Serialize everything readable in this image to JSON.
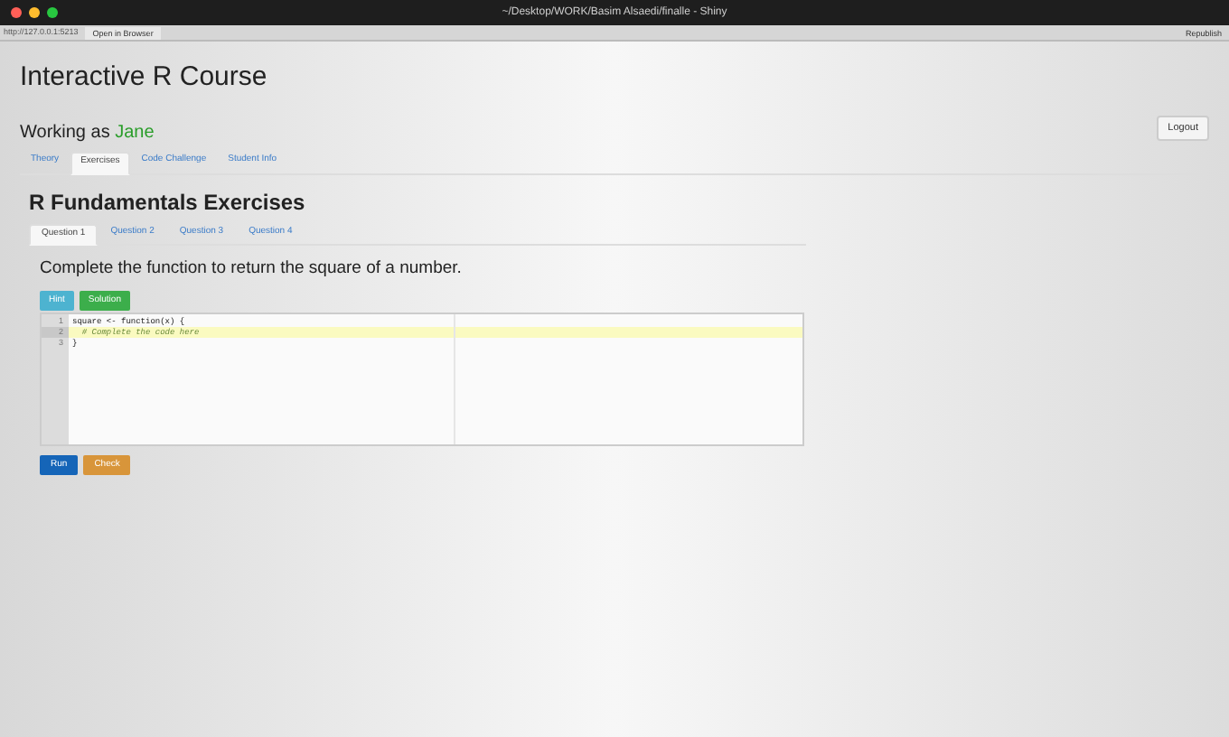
{
  "window": {
    "title": "~/Desktop/WORK/Basim Alsaedi/finalle - Shiny"
  },
  "toolbar": {
    "address": "http://127.0.0.1:5213",
    "open_button": "Open in Browser",
    "publish_button": "Republish"
  },
  "app": {
    "title": "Interactive R Course",
    "user_label": "Working as",
    "user_name": "Jane",
    "logout": "Logout"
  },
  "tabs": [
    {
      "label": "Theory",
      "selected": false
    },
    {
      "label": "Exercises",
      "selected": true
    },
    {
      "label": "Code Challenge",
      "selected": false
    },
    {
      "label": "Student Info",
      "selected": false
    }
  ],
  "section_title": "R Fundamentals Exercises",
  "question_tabs": [
    {
      "label": "Question 1",
      "selected": true
    },
    {
      "label": "Question 2",
      "selected": false
    },
    {
      "label": "Question 3",
      "selected": false
    },
    {
      "label": "Question 4",
      "selected": false
    }
  ],
  "prompt": "Complete the function to return the square of a number.",
  "hint_buttons": [
    "Hint",
    "Solution"
  ],
  "editor": {
    "lines": [
      {
        "number": "1",
        "code": "square <- function(x) {",
        "kind": "code",
        "active": false
      },
      {
        "number": "2",
        "code": "  # Complete the code here",
        "kind": "comment",
        "active": true
      },
      {
        "number": "3",
        "code": "}",
        "kind": "code",
        "active": false
      }
    ]
  },
  "action_buttons": [
    "Run",
    "Check"
  ]
}
